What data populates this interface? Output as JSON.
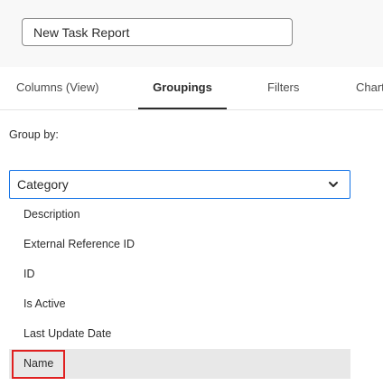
{
  "report": {
    "name_value": "New Task Report"
  },
  "tabs": [
    {
      "label": "Columns (View)"
    },
    {
      "label": "Groupings"
    },
    {
      "label": "Filters"
    },
    {
      "label": "Charts"
    }
  ],
  "groupings": {
    "label": "Group by:",
    "selected": "Category",
    "options": [
      {
        "label": "Description"
      },
      {
        "label": "External Reference ID"
      },
      {
        "label": "ID"
      },
      {
        "label": "Is Active"
      },
      {
        "label": "Last Update Date"
      },
      {
        "label": "Name"
      }
    ]
  },
  "colors": {
    "accent": "#1473e6",
    "highlight": "#e02020",
    "hover": "#e8e8e8"
  }
}
